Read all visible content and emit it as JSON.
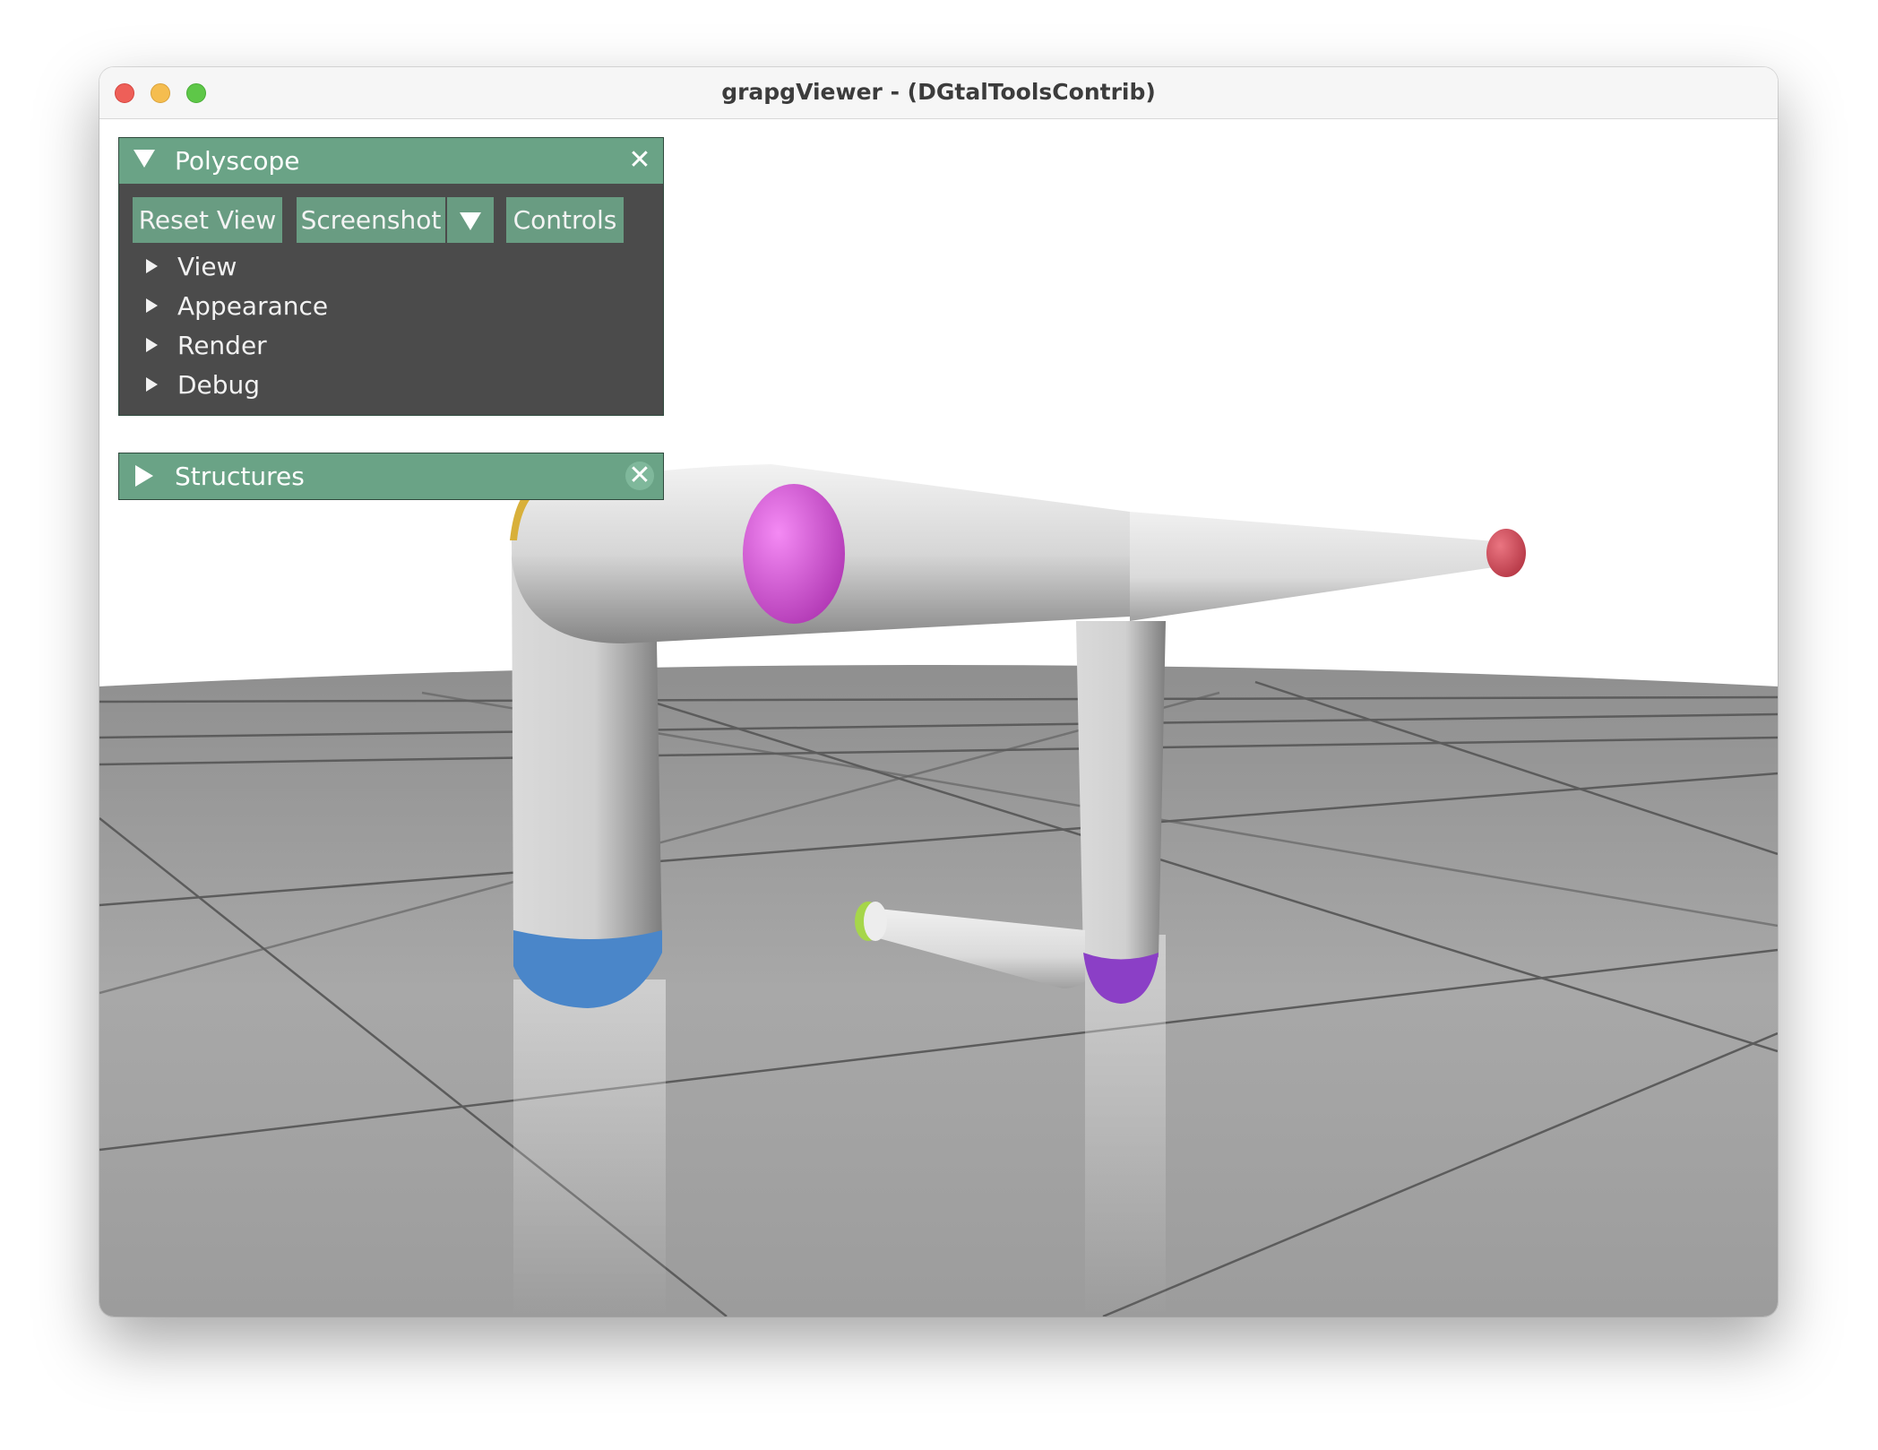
{
  "window": {
    "title": "grapgViewer - (DGtalToolsContrib)"
  },
  "polyscope_panel": {
    "title": "Polyscope",
    "expanded": true,
    "buttons": {
      "reset_view": "Reset View",
      "screenshot": "Screenshot",
      "controls": "Controls"
    },
    "tree_items": [
      "View",
      "Appearance",
      "Render",
      "Debug"
    ]
  },
  "structures_panel": {
    "title": "Structures",
    "expanded": false
  },
  "icons": {
    "panel_close": "close-icon",
    "collapse": "triangle-down-icon",
    "expand": "triangle-right-icon",
    "dropdown": "chevron-down-icon"
  },
  "colors": {
    "panel_header": "#6aa386",
    "panel_body": "#4b4b4b",
    "button": "#699c82",
    "node_magenta": "#e35fe3",
    "node_red": "#d6505e",
    "node_blue": "#4a86c9",
    "node_purple": "#8b3fc6",
    "node_yellow": "#d8b03a",
    "node_green": "#a6d64a",
    "tube": "#d9d9d9",
    "ground": "#a3a3a3"
  }
}
